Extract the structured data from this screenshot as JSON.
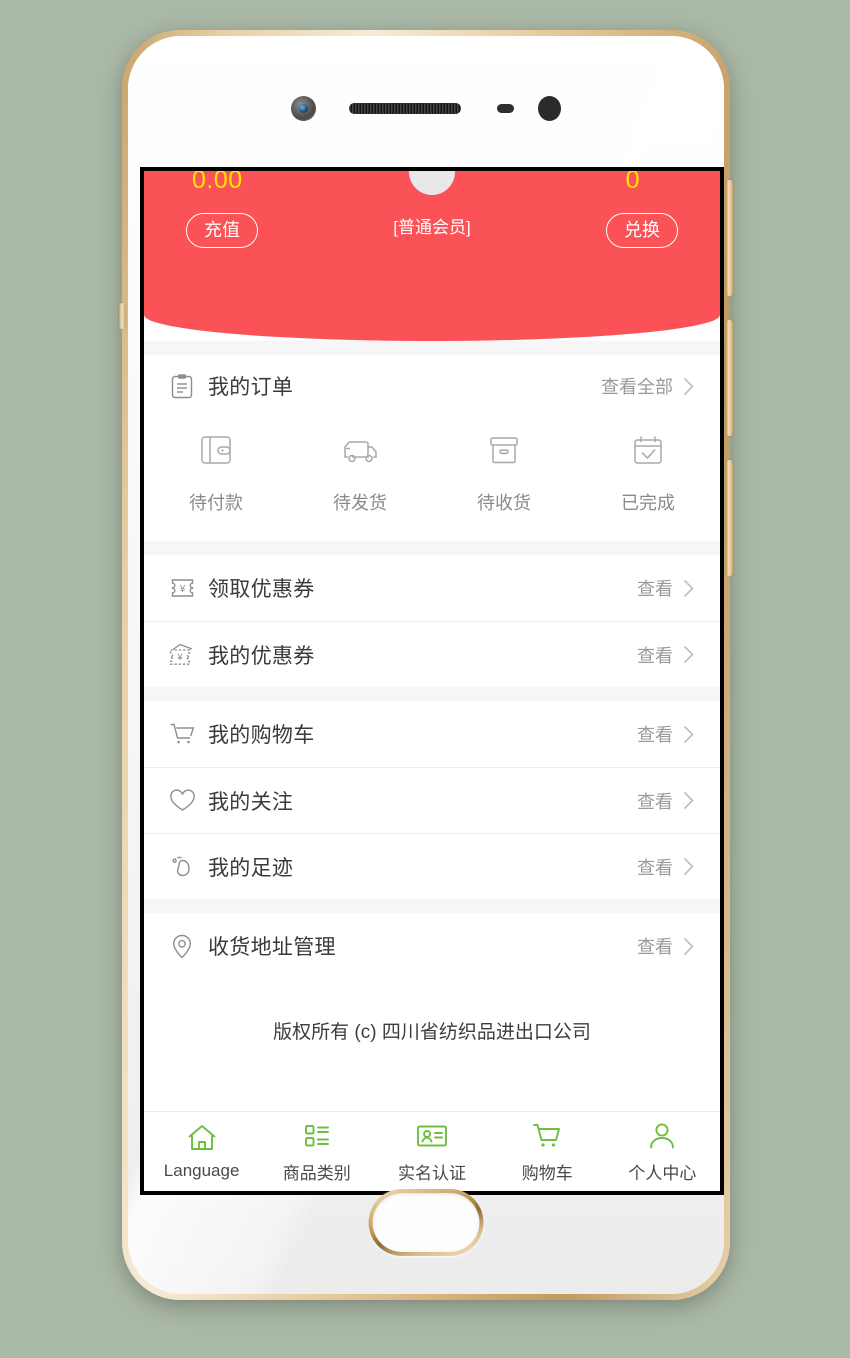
{
  "hero": {
    "balance": "0.00",
    "points": "0",
    "recharge_label": "充值",
    "exchange_label": "兑换",
    "member_level": "[普通会员]",
    "bg_color": "#fb5258",
    "number_color": "#ffe400"
  },
  "orders": {
    "title": "我的订单",
    "view_all_label": "查看全部",
    "items": [
      {
        "label": "待付款",
        "icon": "wallet-icon"
      },
      {
        "label": "待发货",
        "icon": "truck-icon"
      },
      {
        "label": "待收货",
        "icon": "box-icon"
      },
      {
        "label": "已完成",
        "icon": "calendar-check-icon"
      }
    ]
  },
  "sections": [
    {
      "rows": [
        {
          "label": "领取优惠券",
          "action": "查看",
          "icon": "coupon-icon"
        },
        {
          "label": "我的优惠券",
          "action": "查看",
          "icon": "coupon-stack-icon"
        }
      ]
    },
    {
      "rows": [
        {
          "label": "我的购物车",
          "action": "查看",
          "icon": "cart-icon"
        },
        {
          "label": "我的关注",
          "action": "查看",
          "icon": "heart-icon"
        },
        {
          "label": "我的足迹",
          "action": "查看",
          "icon": "footprint-icon"
        }
      ]
    },
    {
      "rows": [
        {
          "label": "收货地址管理",
          "action": "查看",
          "icon": "location-pin-icon"
        }
      ]
    }
  ],
  "copyright": "版权所有 (c) 四川省纺织品进出口公司",
  "tabbar": {
    "accent_color": "#6cbf3f",
    "items": [
      {
        "label": "Language",
        "icon": "home-icon"
      },
      {
        "label": "商品类别",
        "icon": "category-list-icon"
      },
      {
        "label": "实名认证",
        "icon": "id-card-icon"
      },
      {
        "label": "购物车",
        "icon": "cart-icon"
      },
      {
        "label": "个人中心",
        "icon": "user-icon"
      }
    ]
  }
}
